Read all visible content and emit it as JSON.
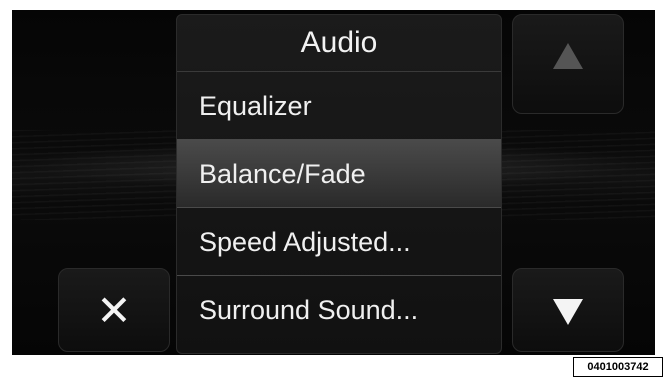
{
  "menu": {
    "title": "Audio",
    "items": [
      {
        "label": "Equalizer",
        "selected": false
      },
      {
        "label": "Balance/Fade",
        "selected": true
      },
      {
        "label": "Speed Adjusted...",
        "selected": false
      },
      {
        "label": "Surround Sound...",
        "selected": false
      }
    ]
  },
  "controls": {
    "close_symbol": "✕",
    "scroll_up_icon": "triangle-up-icon",
    "scroll_down_icon": "triangle-down-icon",
    "scroll_up_enabled": false,
    "scroll_down_enabled": true
  },
  "image_id": "0401003742",
  "colors": {
    "screen_bg": "#0a0a0a",
    "text": "#f0f0f0",
    "selected_bg": "#444444",
    "disabled_arrow": "#555555"
  }
}
